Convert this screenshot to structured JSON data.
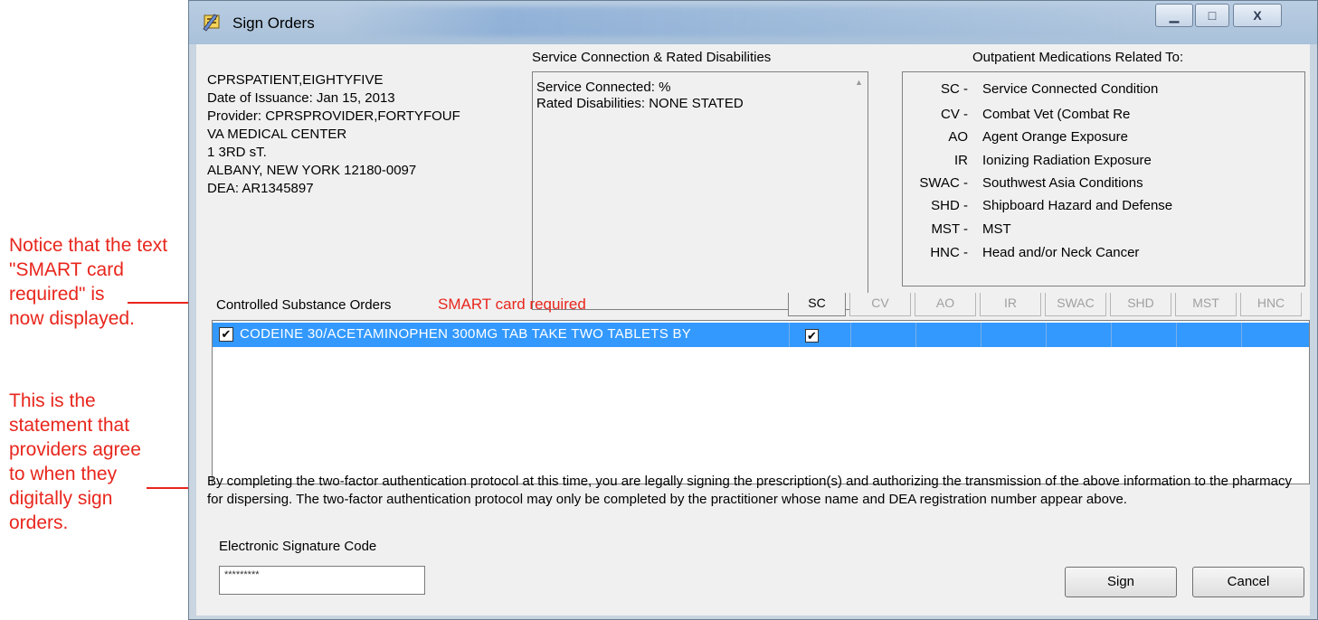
{
  "annotations": {
    "smart_note": "Notice that the text\n\"SMART card\nrequired\" is\nnow displayed.",
    "statement_note": "This is the\nstatement that\nproviders agree\nto when they\ndigitally sign\norders."
  },
  "window": {
    "title": "Sign Orders",
    "minimize_glyph": "▁",
    "maximize_glyph": "□",
    "close_glyph": "X"
  },
  "patient": {
    "lines": [
      "CPRSPATIENT,EIGHTYFIVE",
      "Date of Issuance: Jan 15, 2013",
      "Provider: CPRSPROVIDER,FORTYFOUF",
      "VA MEDICAL CENTER",
      "1 3RD sT.",
      "ALBANY, NEW YORK  12180-0097",
      "DEA: AR1345897"
    ]
  },
  "service_connection": {
    "header": "Service Connection & Rated Disabilities",
    "line1": "Service Connected: %",
    "line2": "Rated Disabilities: NONE STATED"
  },
  "outpatient_meds": {
    "header": "Outpatient Medications Related To:",
    "items": [
      {
        "code": "SC -",
        "desc": "Service Connected Condition"
      },
      {
        "code": "CV -",
        "desc": "Combat Vet (Combat Re"
      },
      {
        "code": "AO",
        "desc": "Agent Orange Exposure"
      },
      {
        "code": "IR",
        "desc": "Ionizing Radiation Exposure"
      },
      {
        "code": "SWAC -",
        "desc": "Southwest Asia Conditions"
      },
      {
        "code": "SHD -",
        "desc": "Shipboard Hazard and Defense"
      },
      {
        "code": "MST -",
        "desc": "MST"
      },
      {
        "code": "HNC -",
        "desc": "Head and/or Neck Cancer"
      }
    ]
  },
  "controlled": {
    "label": "Controlled Substance Orders",
    "smart_text": "SMART card required"
  },
  "columns": [
    "SC",
    "CV",
    "AO",
    "IR",
    "SWAC",
    "SHD",
    "MST",
    "HNC"
  ],
  "orders": [
    {
      "text": "CODEINE 30/ACETAMINOPHEN 300MG TAB  TAKE TWO TABLETS BY",
      "checked": "✔",
      "sc_checked": "✔"
    }
  ],
  "legal_statement": "By completing the two-factor authentication protocol at this time, you are legally signing the prescription(s) and authorizing the transmission of the above information to the pharmacy for dispersing.  The two-factor authentication protocol may only be completed by the practitioner whose name and DEA registration number appear above.",
  "signature": {
    "label": "Electronic Signature Code",
    "value": "*********"
  },
  "buttons": {
    "sign": "Sign",
    "cancel": "Cancel"
  }
}
